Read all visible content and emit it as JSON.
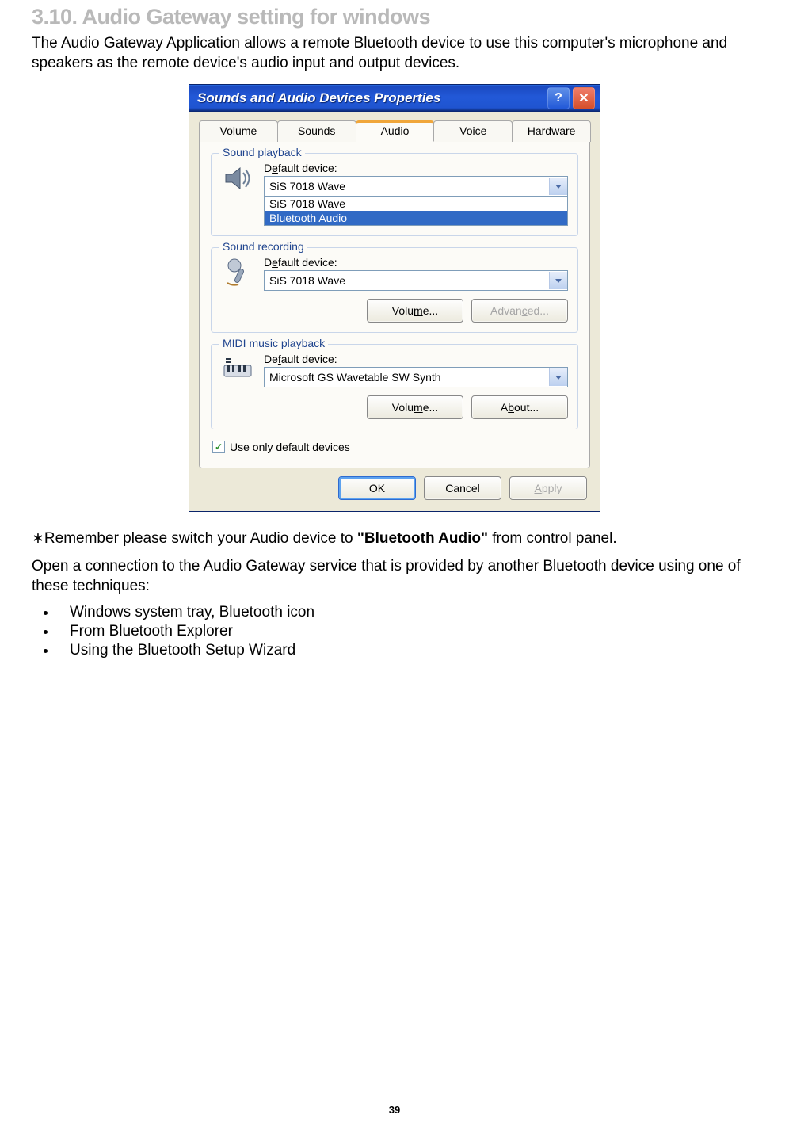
{
  "heading": "3.10. Audio Gateway setting for windows",
  "intro": "The Audio Gateway Application allows a remote Bluetooth device to use this computer's microphone and speakers as the remote device's audio input and output devices.",
  "dialog": {
    "title": "Sounds and Audio Devices Properties",
    "tabs": {
      "volume": "Volume",
      "sounds": "Sounds",
      "audio": "Audio",
      "voice": "Voice",
      "hardware": "Hardware"
    },
    "groups": {
      "playback": {
        "title": "Sound playback",
        "label_prefix": "D",
        "label_ul": "e",
        "label_suffix": "fault device:",
        "value": "SiS 7018 Wave",
        "options": {
          "a": "SiS 7018 Wave",
          "b": "Bluetooth Audio"
        }
      },
      "recording": {
        "title": "Sound recording",
        "label_prefix": "D",
        "label_ul": "e",
        "label_suffix": "fault device:",
        "value": "SiS 7018 Wave",
        "btn_volume_prefix": "Volu",
        "btn_volume_ul": "m",
        "btn_volume_suffix": "e...",
        "btn_advanced_prefix": "Advan",
        "btn_advanced_ul": "c",
        "btn_advanced_suffix": "ed..."
      },
      "midi": {
        "title": "MIDI music playback",
        "label_prefix": "De",
        "label_ul": "f",
        "label_suffix": "ault device:",
        "value": "Microsoft GS Wavetable SW Synth",
        "btn_volume_prefix": "Volu",
        "btn_volume_ul": "m",
        "btn_volume_suffix": "e...",
        "btn_about_prefix": "A",
        "btn_about_ul": "b",
        "btn_about_suffix": "out..."
      }
    },
    "checkbox_ul": "U",
    "checkbox_suffix": "se only default devices",
    "buttons": {
      "ok": "OK",
      "cancel": "Cancel",
      "apply_ul": "A",
      "apply_suffix": "pply"
    }
  },
  "remember_prefix": "∗Remember please switch your Audio device to ",
  "remember_bold": "\"Bluetooth Audio\"",
  "remember_suffix": " from control panel.",
  "open_conn": "Open a connection to the Audio Gateway service that is provided by another Bluetooth device using one of these techniques:",
  "bullets": {
    "a": "Windows system tray, Bluetooth icon",
    "b": "From Bluetooth Explorer",
    "c": "Using the Bluetooth Setup Wizard"
  },
  "page_number": "39"
}
